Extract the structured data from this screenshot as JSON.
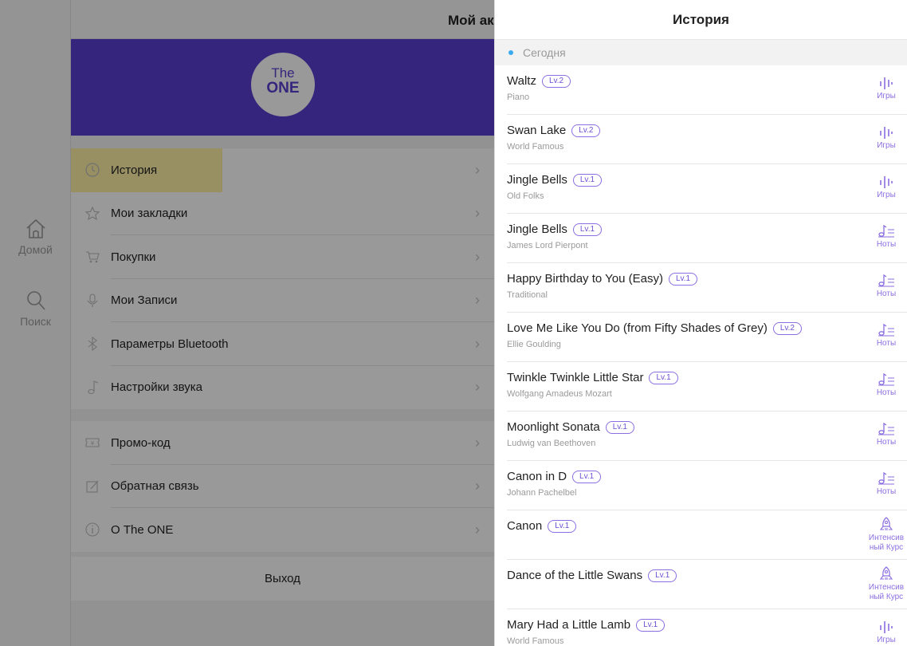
{
  "rail": {
    "home_label": "Домой",
    "search_label": "Поиск"
  },
  "panel": {
    "title": "Мой аккаунт",
    "logo_line1": "The",
    "logo_line2": "ONE",
    "brand_color": "#5a3fd0",
    "menu_group1": [
      {
        "label": "История",
        "icon": "clock-icon"
      },
      {
        "label": "Мои закладки",
        "icon": "star-icon"
      },
      {
        "label": "Покупки",
        "icon": "cart-icon"
      },
      {
        "label": "Мои Записи",
        "icon": "microphone-icon"
      },
      {
        "label": "Параметры Bluetooth",
        "icon": "bluetooth-icon"
      },
      {
        "label": "Настройки звука",
        "icon": "music-note-icon"
      }
    ],
    "menu_group2": [
      {
        "label": "Промо-код",
        "icon": "ticket-icon"
      },
      {
        "label": "Обратная связь",
        "icon": "edit-icon"
      },
      {
        "label": "О The ONE",
        "icon": "info-icon"
      }
    ],
    "logout_label": "Выход"
  },
  "history": {
    "title": "История",
    "section_label": "Сегодня",
    "accent_color": "#8b6ee0",
    "items": [
      {
        "title": "Waltz",
        "level": "Lv.2",
        "subtitle": "Piano",
        "tag": "Игры",
        "tag_icon": "waveform-icon"
      },
      {
        "title": "Swan Lake",
        "level": "Lv.2",
        "subtitle": "World Famous",
        "tag": "Игры",
        "tag_icon": "waveform-icon"
      },
      {
        "title": "Jingle Bells",
        "level": "Lv.1",
        "subtitle": "Old Folks",
        "tag": "Игры",
        "tag_icon": "waveform-icon"
      },
      {
        "title": "Jingle Bells",
        "level": "Lv.1",
        "subtitle": "James Lord Pierpont",
        "tag": "Ноты",
        "tag_icon": "sheet-music-icon"
      },
      {
        "title": "Happy Birthday to You (Easy)",
        "level": "Lv.1",
        "subtitle": "Traditional",
        "tag": "Ноты",
        "tag_icon": "sheet-music-icon"
      },
      {
        "title": "Love Me Like You Do (from Fifty Shades of Grey)",
        "level": "Lv.2",
        "subtitle": "Ellie Goulding",
        "tag": "Ноты",
        "tag_icon": "sheet-music-icon"
      },
      {
        "title": "Twinkle Twinkle Little Star",
        "level": "Lv.1",
        "subtitle": "Wolfgang Amadeus Mozart",
        "tag": "Ноты",
        "tag_icon": "sheet-music-icon"
      },
      {
        "title": "Moonlight Sonata",
        "level": "Lv.1",
        "subtitle": "Ludwig van Beethoven",
        "tag": "Ноты",
        "tag_icon": "sheet-music-icon"
      },
      {
        "title": "Canon in D",
        "level": "Lv.1",
        "subtitle": "Johann Pachelbel",
        "tag": "Ноты",
        "tag_icon": "sheet-music-icon"
      },
      {
        "title": "Canon",
        "level": "Lv.1",
        "subtitle": "",
        "tag": "Интенсив ный Курс",
        "tag_icon": "rocket-icon"
      },
      {
        "title": "Dance of the Little Swans",
        "level": "Lv.1",
        "subtitle": "",
        "tag": "Интенсив ный Курс",
        "tag_icon": "rocket-icon"
      },
      {
        "title": "Mary Had a Little Lamb",
        "level": "Lv.1",
        "subtitle": "World Famous",
        "tag": "Игры",
        "tag_icon": "waveform-icon"
      }
    ]
  }
}
